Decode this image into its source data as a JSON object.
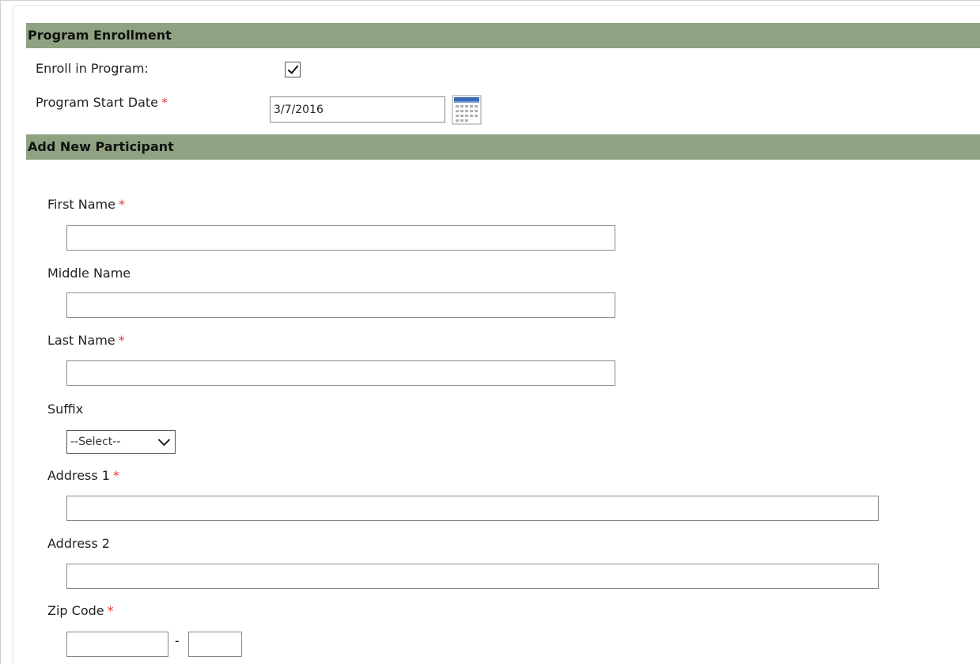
{
  "sections": {
    "program_enrollment": "Program Enrollment",
    "add_participant": "Add New Participant"
  },
  "enrollment": {
    "enroll_label": "Enroll in Program:",
    "enroll_checked": true,
    "start_date_label": "Program Start Date",
    "start_date_value": "3/7/2016"
  },
  "participant": {
    "first_name_label": "First Name",
    "middle_name_label": "Middle Name",
    "last_name_label": "Last Name",
    "suffix_label": "Suffix",
    "suffix_selected": "--Select--",
    "address1_label": "Address 1",
    "address2_label": "Address 2",
    "zip_label": "Zip Code",
    "zip_separator": "-"
  },
  "required_marker": "*",
  "colors": {
    "header_bg": "#8fa382",
    "required": "#e23b3b"
  },
  "icons": {
    "calendar": "calendar-icon",
    "dropdown": "chevron-down-icon",
    "check": "check-icon"
  }
}
